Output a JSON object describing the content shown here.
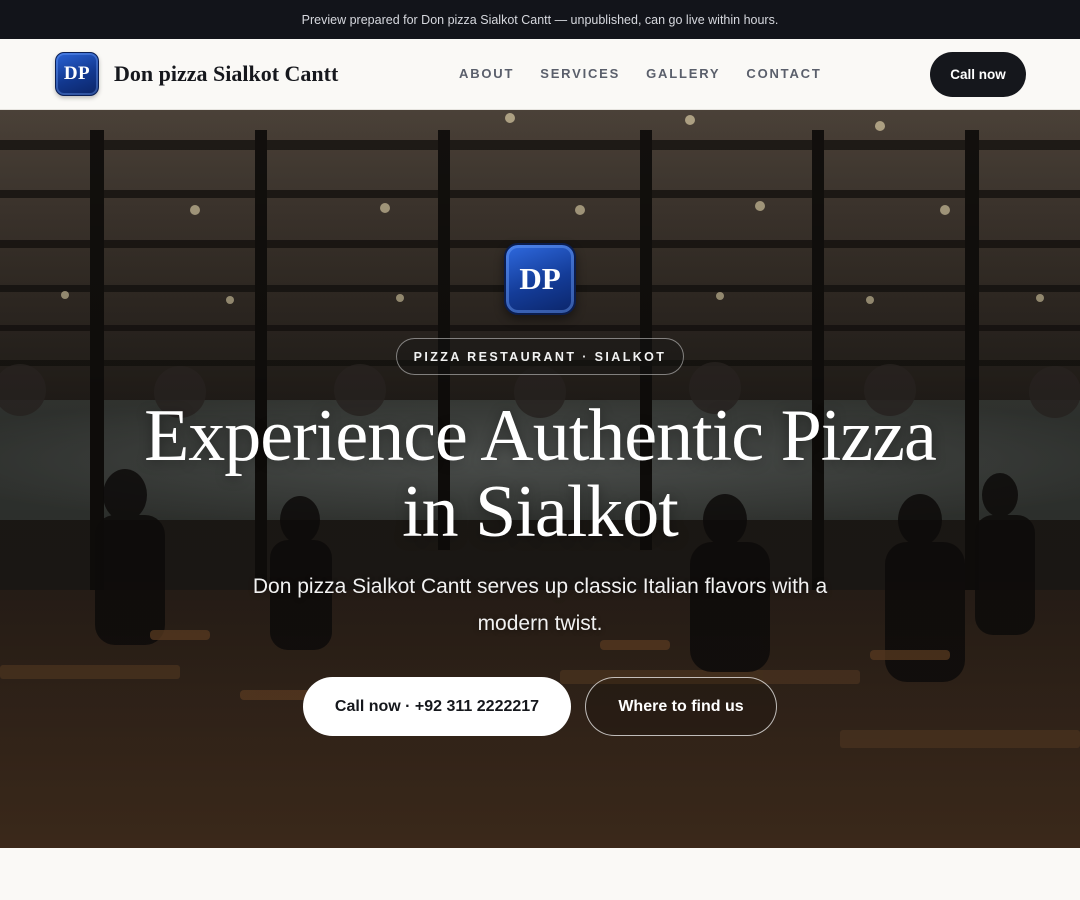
{
  "preview_bar": {
    "text": "Preview prepared for Don pizza Sialkot Cantt — unpublished, can go live within hours."
  },
  "header": {
    "logo_initials": "DP",
    "brand_name": "Don pizza Sialkot Cantt",
    "nav": [
      "ABOUT",
      "SERVICES",
      "GALLERY",
      "CONTACT"
    ],
    "cta_label": "Call now"
  },
  "hero": {
    "logo_initials": "DP",
    "eyebrow": "PIZZA RESTAURANT · SIALKOT",
    "title_line1": "Experience Authentic Pizza",
    "title_line2": "in Sialkot",
    "subtitle": "Don pizza Sialkot Cantt serves up classic Italian flavors with a modern twist.",
    "primary_button": "Call now · +92 311 2222217",
    "secondary_button": "Where to find us"
  },
  "colors": {
    "accent_dark": "#15171c",
    "logo_blue": "#143c98",
    "page_bg": "#faf9f6"
  }
}
